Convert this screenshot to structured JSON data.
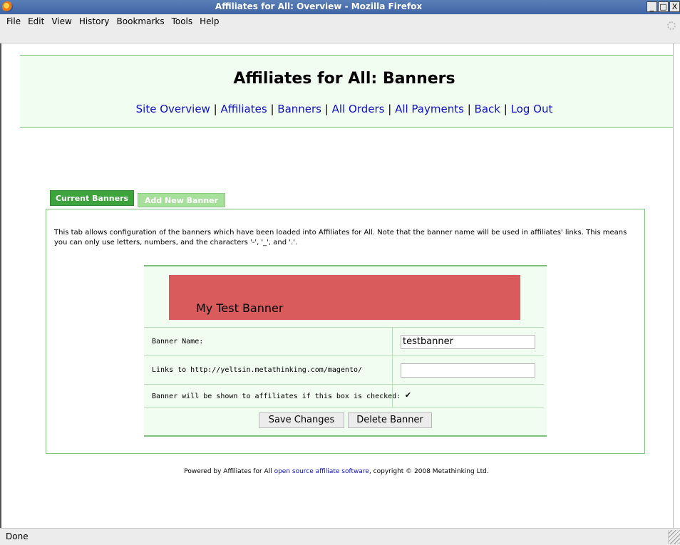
{
  "window": {
    "title": "Affiliates for All: Overview - Mozilla Firefox",
    "buttons": [
      "_",
      "□",
      "X"
    ]
  },
  "menubar": {
    "items": [
      "File",
      "Edit",
      "View",
      "History",
      "Bookmarks",
      "Tools",
      "Help"
    ]
  },
  "page": {
    "heading": "Affiliates for All: Banners",
    "nav": [
      "Site Overview",
      "Affiliates",
      "Banners",
      "All Orders",
      "All Payments",
      "Back",
      "Log Out"
    ],
    "nav_separator": "|"
  },
  "tabs": {
    "current": "Current Banners",
    "add": "Add New Banner"
  },
  "description": "This tab allows configuration of the banners which have been loaded into Affiliates for All. Note that the banner name will be used in affiliates' links. This means you can only use letters, numbers, and the characters '-', '_', and '.'.",
  "banner": {
    "preview_text": "My Test Banner",
    "preview_color": "#d95b5b",
    "name_label": "Banner Name:",
    "name_value": "testbanner",
    "link_label": "Links to http://yeltsin.metathinking.com/magento/",
    "link_value": "",
    "shown_label": "Banner will be shown to affiliates if this box is checked:",
    "shown_checked": "✔",
    "save_label": "Save Changes",
    "delete_label": "Delete Banner"
  },
  "footer": {
    "prefix": "Powered by Affiliates for All ",
    "link": "open source affiliate software",
    "suffix": ", copyright © 2008 Metathinking Ltd."
  },
  "statusbar": {
    "text": "Done"
  },
  "colors": {
    "header_bg": "#f0fdf0",
    "accent_green": "#3da33d",
    "link_blue": "#1010c8"
  }
}
